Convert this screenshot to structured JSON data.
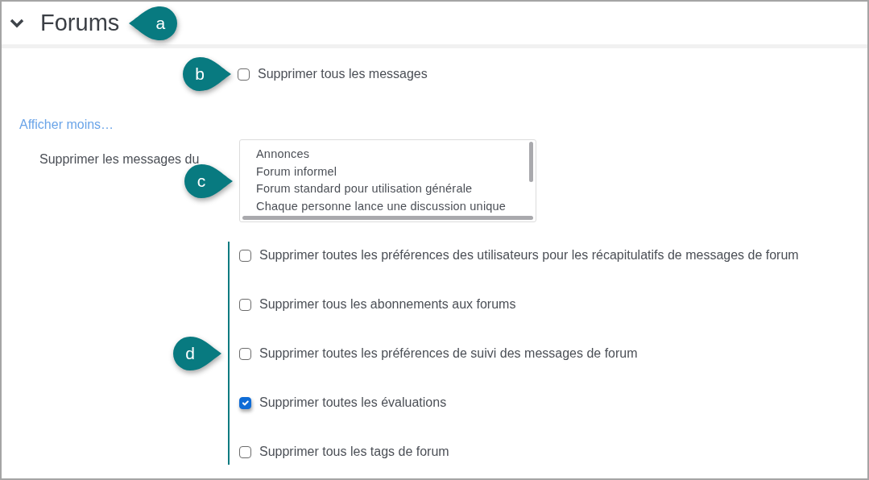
{
  "section": {
    "title": "Forums",
    "expanded": true,
    "callout": "a"
  },
  "delete_all": {
    "label": "Supprimer tous les messages",
    "checked": false,
    "callout": "b"
  },
  "toggle_link": "Afficher moins…",
  "forum_types": {
    "label": "Supprimer les messages du",
    "callout": "c",
    "options": [
      {
        "label": "Annonces",
        "selected": false
      },
      {
        "label": "Forum informel",
        "selected": false
      },
      {
        "label": "Forum standard pour utilisation générale",
        "selected": false
      },
      {
        "label": "Chaque personne lance une discussion unique",
        "selected": false
      }
    ]
  },
  "options_callout": "d",
  "options": [
    {
      "label": "Supprimer toutes les préférences des utilisateurs pour les récapitulatifs de messages de forum",
      "checked": false
    },
    {
      "label": "Supprimer tous les abonnements aux forums",
      "checked": false
    },
    {
      "label": "Supprimer toutes les préférences de suivi des messages de forum",
      "checked": false
    },
    {
      "label": "Supprimer toutes les évaluations",
      "checked": true
    },
    {
      "label": "Supprimer tous les tags de forum",
      "checked": false
    }
  ]
}
